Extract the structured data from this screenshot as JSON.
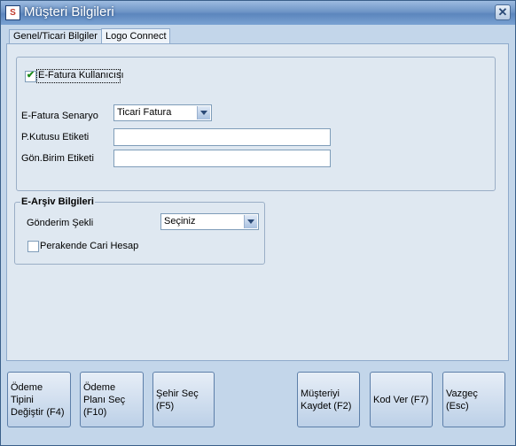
{
  "window": {
    "title": "Müşteri Bilgileri",
    "icon_text": "S",
    "close_symbol": "✕"
  },
  "tabs": [
    {
      "label": "Genel/Ticari Bilgiler",
      "active": false
    },
    {
      "label": "Logo Connect",
      "active": true
    }
  ],
  "efatura": {
    "checkbox_label": "E-Fatura Kullanıcısı",
    "checked": true,
    "senaryo_label": "E-Fatura Senaryo",
    "senaryo_value": "Ticari Fatura",
    "pkutusu_label": "P.Kutusu Etiketi",
    "pkutusu_value": "",
    "gonbirim_label": "Gön.Birim Etiketi",
    "gonbirim_value": ""
  },
  "earsiv": {
    "legend": "E-Arşiv Bilgileri",
    "gonderim_label": "Gönderim Şekli",
    "gonderim_value": "Seçiniz",
    "perakende_label": "Perakende Cari Hesap",
    "perakende_checked": false
  },
  "buttons": {
    "odeme_tipi": "Ödeme Tipini Değiştir (F4)",
    "odeme_plani": "Ödeme Planı Seç (F10)",
    "sehir_sec": "Şehir Seç (F5)",
    "musteri_kaydet": "Müşteriyi Kaydet (F2)",
    "kod_ver": "Kod Ver (F7)",
    "vazgec": "Vazgeç (Esc)"
  },
  "colors": {
    "titlebar": "#6f96c7",
    "window_bg": "#c3d6ea",
    "panel_bg": "#dfe8f1",
    "check": "#1a8a1a"
  },
  "icons": {
    "close": "close-icon",
    "app": "app-logo-icon",
    "dropdown": "chevron-down-icon",
    "check": "checkmark-icon"
  }
}
